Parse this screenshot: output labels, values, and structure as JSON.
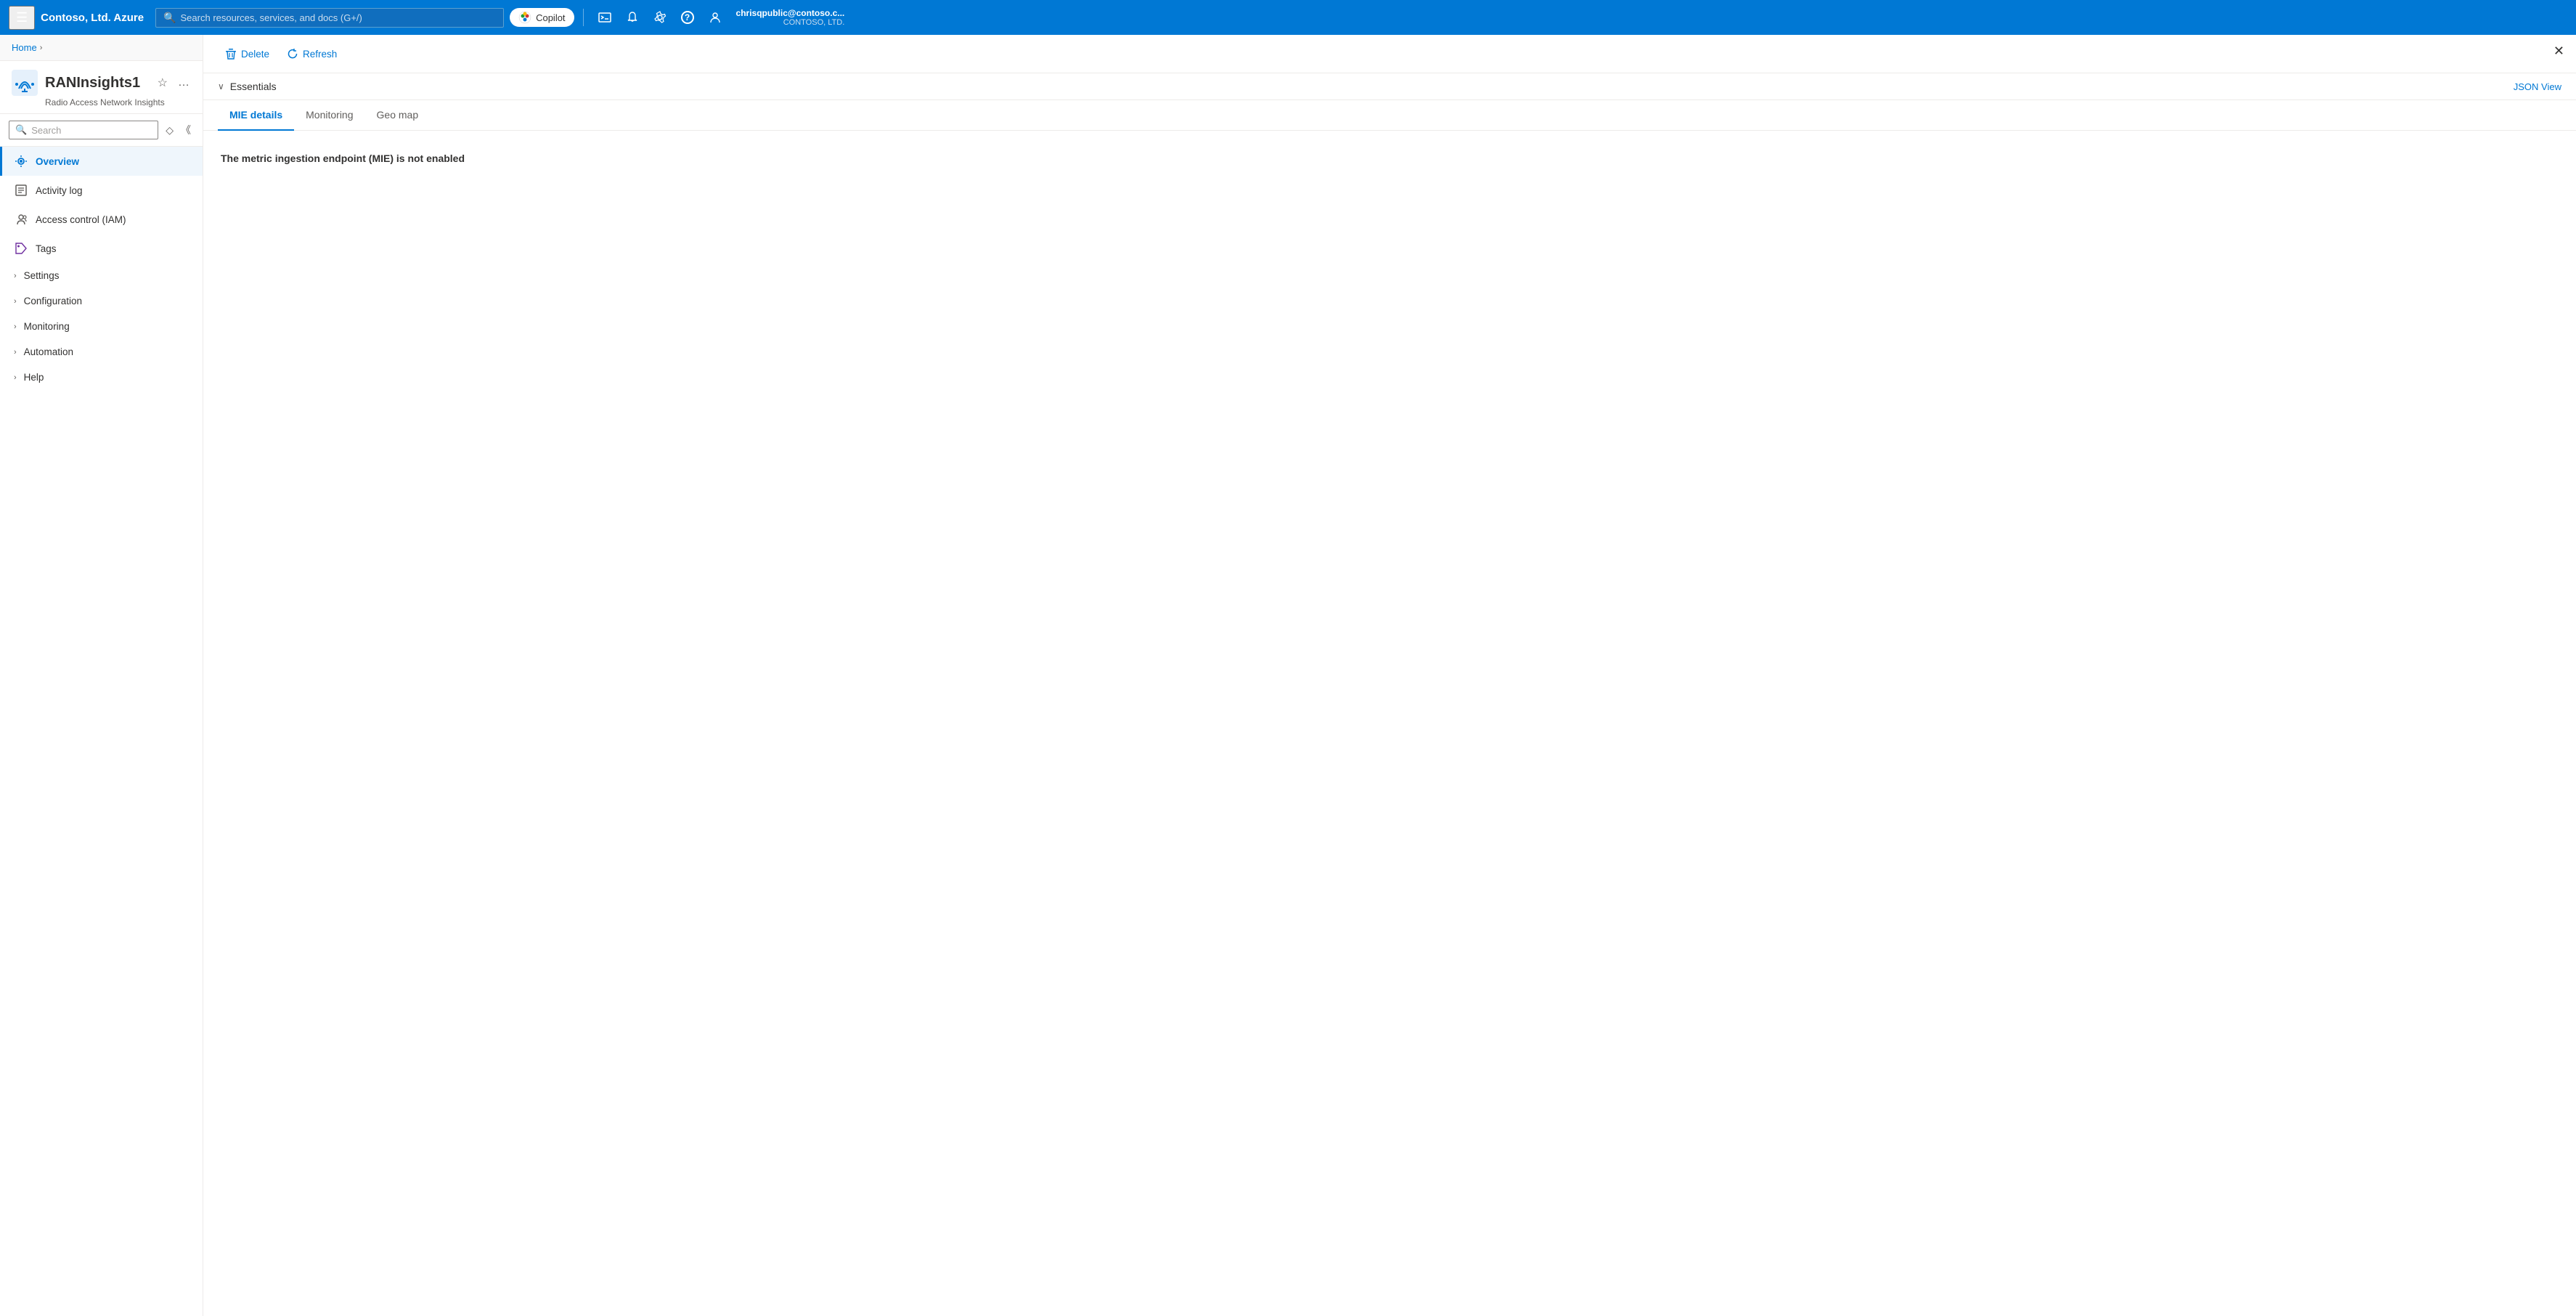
{
  "topnav": {
    "hamburger_icon": "☰",
    "title": "Contoso, Ltd. Azure",
    "search_placeholder": "Search resources, services, and docs (G+/)",
    "copilot_label": "Copilot",
    "icons": [
      {
        "name": "terminal-icon",
        "symbol": "⬛",
        "label": "Cloud Shell"
      },
      {
        "name": "bell-icon",
        "symbol": "🔔",
        "label": "Notifications"
      },
      {
        "name": "gear-icon",
        "symbol": "⚙",
        "label": "Settings"
      },
      {
        "name": "question-icon",
        "symbol": "?",
        "label": "Help"
      },
      {
        "name": "feedback-icon",
        "symbol": "💬",
        "label": "Feedback"
      }
    ],
    "user": {
      "name": "chrisqpublic@contoso.c...",
      "org": "CONTOSO, LTD."
    }
  },
  "breadcrumb": {
    "home_label": "Home",
    "chevron": "›"
  },
  "resource": {
    "name": "RANInsights1",
    "subtitle": "Radio Access Network Insights",
    "star_icon": "☆",
    "more_icon": "…"
  },
  "sidebar": {
    "search_placeholder": "Search",
    "nav_items": [
      {
        "id": "overview",
        "label": "Overview",
        "icon": "📡",
        "active": true,
        "has_chevron": false
      },
      {
        "id": "activity-log",
        "label": "Activity log",
        "icon": "📋",
        "active": false,
        "has_chevron": false
      },
      {
        "id": "access-control",
        "label": "Access control (IAM)",
        "icon": "👤",
        "active": false,
        "has_chevron": false
      },
      {
        "id": "tags",
        "label": "Tags",
        "icon": "🏷",
        "active": false,
        "has_chevron": false
      },
      {
        "id": "settings",
        "label": "Settings",
        "icon": null,
        "active": false,
        "has_chevron": true
      },
      {
        "id": "configuration",
        "label": "Configuration",
        "icon": null,
        "active": false,
        "has_chevron": true
      },
      {
        "id": "monitoring",
        "label": "Monitoring",
        "icon": null,
        "active": false,
        "has_chevron": true
      },
      {
        "id": "automation",
        "label": "Automation",
        "icon": null,
        "active": false,
        "has_chevron": true
      },
      {
        "id": "help",
        "label": "Help",
        "icon": null,
        "active": false,
        "has_chevron": true
      }
    ]
  },
  "toolbar": {
    "delete_label": "Delete",
    "refresh_label": "Refresh"
  },
  "essentials": {
    "label": "Essentials",
    "json_view_label": "JSON View",
    "chevron": "∨"
  },
  "tabs": [
    {
      "id": "mie-details",
      "label": "MIE details",
      "active": true
    },
    {
      "id": "monitoring",
      "label": "Monitoring",
      "active": false
    },
    {
      "id": "geo-map",
      "label": "Geo map",
      "active": false
    }
  ],
  "main": {
    "mie_message": "The metric ingestion endpoint (MIE) is not enabled"
  },
  "colors": {
    "azure_blue": "#0078d4",
    "nav_bg": "#0078d4",
    "active_nav_border": "#0078d4"
  }
}
